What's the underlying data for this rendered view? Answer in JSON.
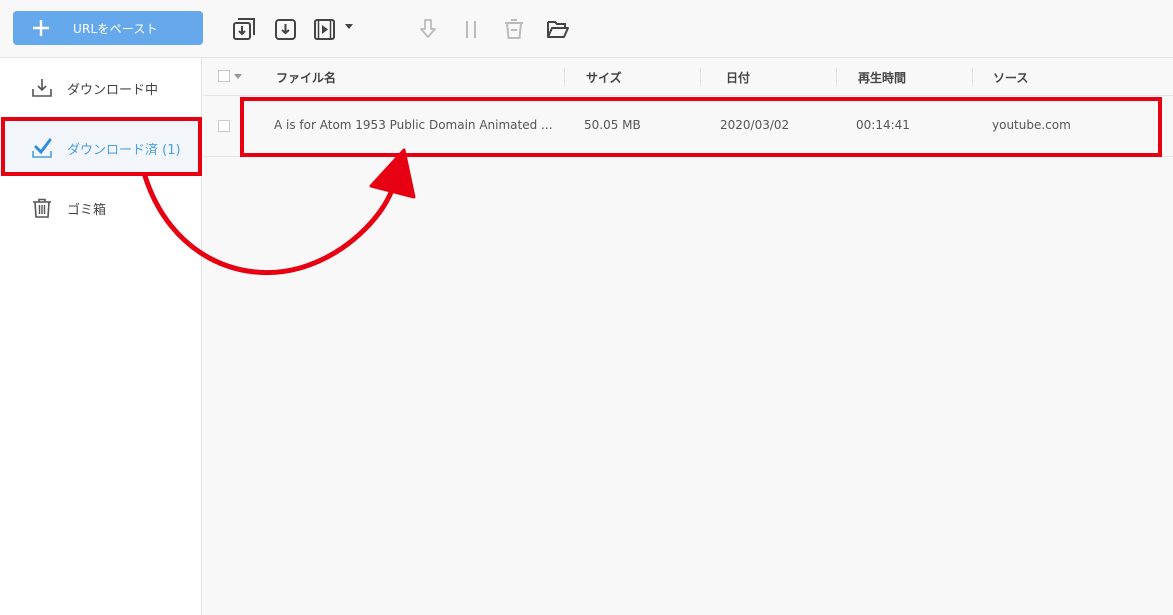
{
  "toolbar": {
    "paste_label": "URLをペースト"
  },
  "sidebar": {
    "items": [
      {
        "label": "ダウンロード中"
      },
      {
        "label": "ダウンロード済 (1)"
      },
      {
        "label": "ゴミ箱"
      }
    ]
  },
  "table": {
    "columns": [
      "ファイル名",
      "サイズ",
      "日付",
      "再生時間",
      "ソース"
    ],
    "rows": [
      {
        "name": "A is for Atom 1953   Public Domain Animated ...",
        "size": "50.05 MB",
        "date": "2020/03/02",
        "duration": "00:14:41",
        "source": "youtube.com"
      }
    ]
  },
  "colors": {
    "accent": "#65a8ec",
    "active_text": "#4b9fe3",
    "annotation": "#e60012"
  },
  "icons": [
    "plus-icon",
    "download-copy-icon",
    "download-icon",
    "video-convert-icon",
    "dropdown-caret-icon",
    "resume-icon",
    "pause-icon",
    "delete-icon",
    "open-folder-icon",
    "download-tray-icon",
    "check-icon",
    "trash-icon"
  ]
}
